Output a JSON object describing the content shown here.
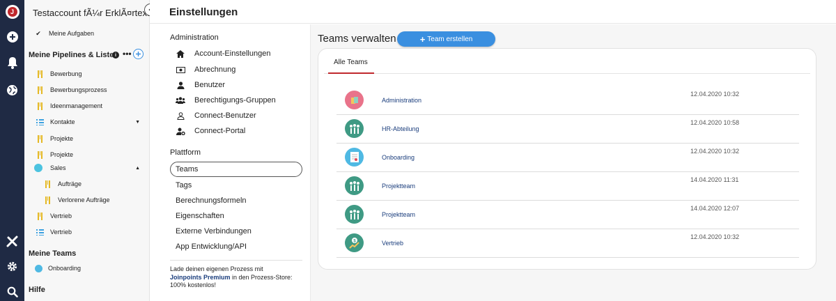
{
  "rail": {
    "logo_letter": "J",
    "icons": [
      "add-icon",
      "bell-icon",
      "globe-icon",
      "tools-icon",
      "gear-icon",
      "search-icon"
    ]
  },
  "sidebar": {
    "account_name": "Testaccount fÃ¼r ErklÃ¤rtexte",
    "collapse_icon": "‹",
    "my_tasks": "Meine Aufgaben",
    "pipelines_heading": "Meine Pipelines & Listen",
    "items": [
      {
        "label": "Bewerbung",
        "icon": "pipeline-icon"
      },
      {
        "label": "Bewerbungsprozess",
        "icon": "pipeline-icon"
      },
      {
        "label": "Ideenmanagement",
        "icon": "pipeline-icon"
      },
      {
        "label": "Kontakte",
        "icon": "list-icon"
      },
      {
        "label": "Projekte",
        "icon": "pipeline-icon"
      },
      {
        "label": "Projekte",
        "icon": "pipeline-icon"
      },
      {
        "label": "Sales",
        "icon": "folder-dot-icon"
      },
      {
        "label": "Aufträge",
        "icon": "pipeline-icon"
      },
      {
        "label": "Verlorene Aufträge",
        "icon": "pipeline-icon"
      },
      {
        "label": "Vertrieb",
        "icon": "pipeline-icon"
      },
      {
        "label": "Vertrieb",
        "icon": "list-icon"
      }
    ],
    "teams_heading": "Meine Teams",
    "team_item": "Onboarding",
    "help_heading": "Hilfe"
  },
  "header": {
    "title": "Einstellungen"
  },
  "settings_nav": {
    "admin_heading": "Administration",
    "admin_items": [
      {
        "label": "Account-Einstellungen",
        "icon": "home-icon"
      },
      {
        "label": "Abrechnung",
        "icon": "money-icon"
      },
      {
        "label": "Benutzer",
        "icon": "user-icon"
      },
      {
        "label": "Berechtigungs-Gruppen",
        "icon": "users-icon"
      },
      {
        "label": "Connect-Benutzer",
        "icon": "user-outline-icon"
      },
      {
        "label": "Connect-Portal",
        "icon": "user-gear-icon"
      }
    ],
    "platform_heading": "Plattform",
    "platform_items": [
      "Teams",
      "Tags",
      "Berechnungsformeln",
      "Eigenschaften",
      "Externe Verbindungen",
      "App Entwicklung/API"
    ],
    "promo_pre": "Lade deinen eigenen Prozess mit ",
    "promo_bold": "Joinpoints Premium",
    "promo_post": " in den Prozess-Store: 100% kostenlos!"
  },
  "main": {
    "title": "Teams verwalten",
    "create_button": "Team erstellen",
    "tab_all": "Alle Teams",
    "teams": [
      {
        "name": "Administration",
        "date": "12.04.2020 10:32",
        "avatar": "admin-avatar-icon",
        "color": "#e9738a"
      },
      {
        "name": "HR-Abteilung",
        "date": "12.04.2020 10:58",
        "avatar": "people-avatar-icon",
        "color": "#3f9a84"
      },
      {
        "name": "Onboarding",
        "date": "12.04.2020 10:32",
        "avatar": "document-avatar-icon",
        "color": "#4fb9e3"
      },
      {
        "name": "Projektteam",
        "date": "14.04.2020 11:31",
        "avatar": "people-avatar-icon",
        "color": "#3f9a84"
      },
      {
        "name": "Projektteam",
        "date": "14.04.2020 12:07",
        "avatar": "people-avatar-icon",
        "color": "#3f9a84"
      },
      {
        "name": "Vertrieb",
        "date": "12.04.2020 10:32",
        "avatar": "money-avatar-icon",
        "color": "#3f9a84"
      }
    ]
  }
}
